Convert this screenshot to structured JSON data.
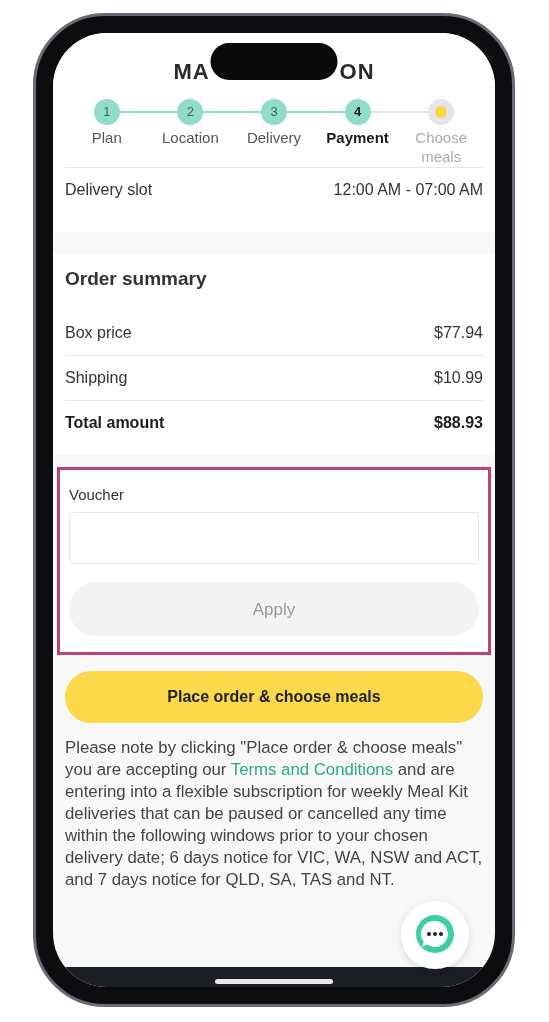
{
  "logo": {
    "left": "MA",
    "right": "ON"
  },
  "steps": [
    {
      "number": "1",
      "label": "Plan",
      "completed": true,
      "selected": false
    },
    {
      "number": "2",
      "label": "Location",
      "completed": true,
      "selected": false
    },
    {
      "number": "3",
      "label": "Delivery",
      "completed": true,
      "selected": false
    },
    {
      "number": "4",
      "label": "Payment",
      "completed": false,
      "selected": true
    },
    {
      "label": "Choose meals",
      "completed": false,
      "selected": false
    }
  ],
  "delivery_slot": {
    "label": "Delivery slot",
    "value": "12:00 AM - 07:00 AM"
  },
  "order_summary": {
    "title": "Order summary",
    "rows": [
      {
        "label": "Box price",
        "value": "$77.94",
        "total": false
      },
      {
        "label": "Shipping",
        "value": "$10.99",
        "total": false
      },
      {
        "label": "Total amount",
        "value": "$88.93",
        "total": true
      }
    ]
  },
  "voucher": {
    "label": "Voucher",
    "highlighted": true,
    "apply": {
      "label": "Apply",
      "disabled": true
    }
  },
  "place_order": {
    "label": "Place order & choose meals"
  },
  "notice": {
    "before": "Please note by clicking \"Place order & choose meals\" you are accepting our ",
    "link": "Terms and Conditions",
    "after": " and are entering into a flexible subscription for weekly Meal Kit deliveries that can be paused or cancelled any time within the following windows prior to your chosen delivery date; 6 days notice for VIC, WA, NSW and ACT, and 7 days notice for QLD, SA, TAS and NT."
  }
}
